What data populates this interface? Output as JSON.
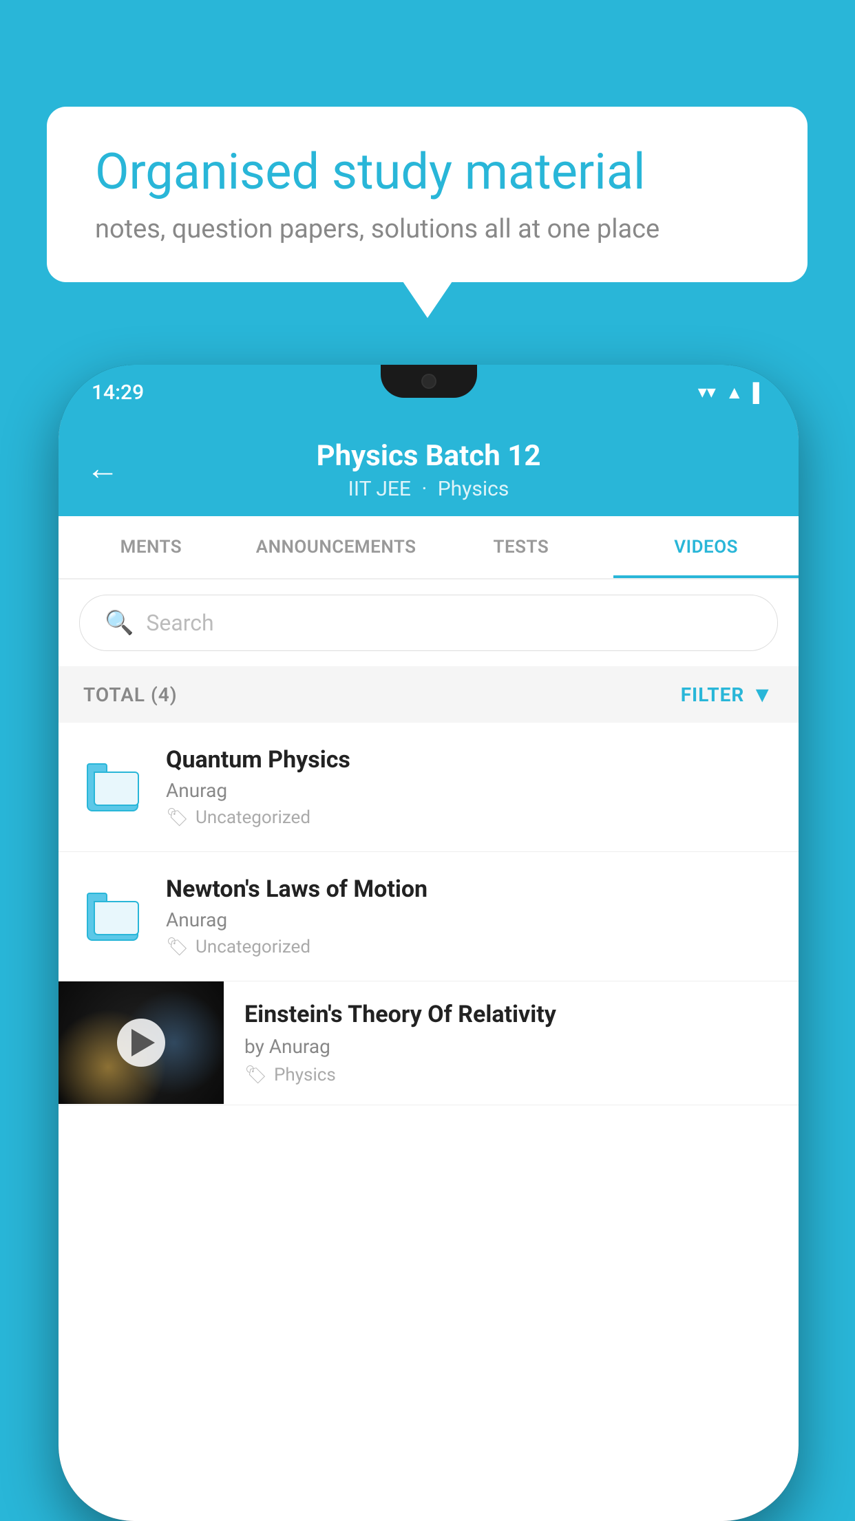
{
  "background_color": "#29b6d8",
  "speech_bubble": {
    "title": "Organised study material",
    "subtitle": "notes, question papers, solutions all at one place"
  },
  "phone": {
    "status_bar": {
      "time": "14:29",
      "icons": [
        "wifi",
        "signal",
        "battery"
      ]
    },
    "header": {
      "title": "Physics Batch 12",
      "subtitle_part1": "IIT JEE",
      "subtitle_part2": "Physics",
      "back_label": "←"
    },
    "tabs": [
      {
        "label": "MENTS",
        "active": false
      },
      {
        "label": "ANNOUNCEMENTS",
        "active": false
      },
      {
        "label": "TESTS",
        "active": false
      },
      {
        "label": "VIDEOS",
        "active": true
      }
    ],
    "search": {
      "placeholder": "Search"
    },
    "filter_bar": {
      "total_label": "TOTAL (4)",
      "filter_label": "FILTER"
    },
    "list_items": [
      {
        "type": "folder",
        "title": "Quantum Physics",
        "author": "Anurag",
        "tag": "Uncategorized"
      },
      {
        "type": "folder",
        "title": "Newton's Laws of Motion",
        "author": "Anurag",
        "tag": "Uncategorized"
      },
      {
        "type": "video",
        "title": "Einstein's Theory Of Relativity",
        "author": "by Anurag",
        "tag": "Physics"
      }
    ]
  }
}
